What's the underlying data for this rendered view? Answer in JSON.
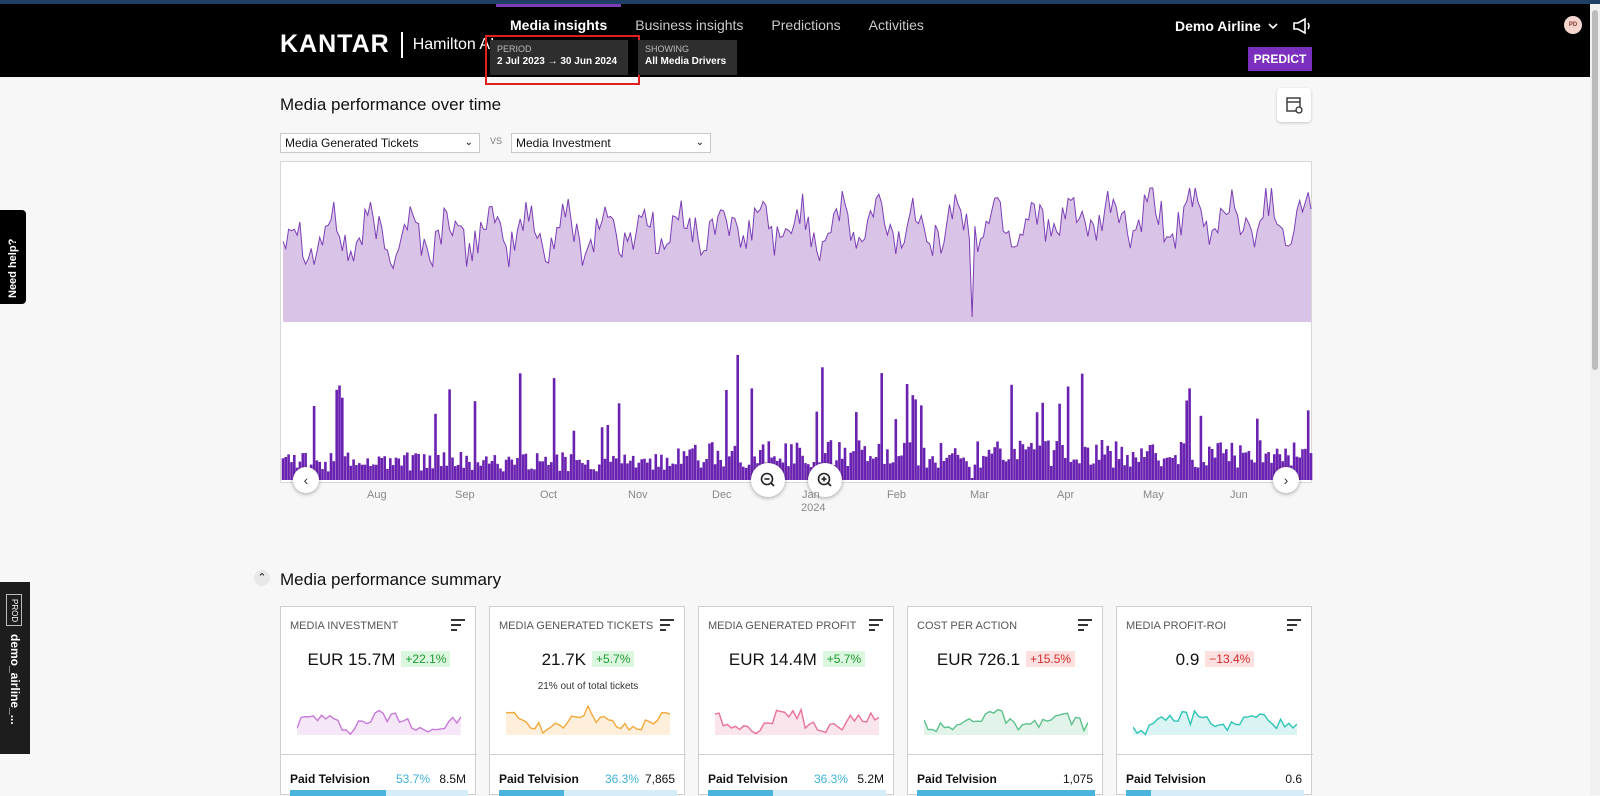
{
  "brand": {
    "logo": "KANTAR",
    "product": "Hamilton AI"
  },
  "nav": {
    "tabs": [
      "Media insights",
      "Business insights",
      "Predictions",
      "Activities"
    ],
    "active": 0
  },
  "period": {
    "label": "PERIOD",
    "value": "2 Jul 2023 → 30 Jun 2024"
  },
  "showing": {
    "label": "SHOWING",
    "value": "All Media Drivers"
  },
  "account": {
    "name": "Demo Airline",
    "predict_label": "PREDICT",
    "avatar": "PD"
  },
  "sidebar": {
    "need_help": "Need help?",
    "env": "PROD",
    "account_id": "demo_airline_..."
  },
  "performance": {
    "title": "Media performance over time",
    "metric_a": "Media Generated Tickets",
    "vs": "VS",
    "metric_b": "Media Investment",
    "months": [
      "Aug",
      "Sep",
      "Oct",
      "Nov",
      "Dec",
      "Jan",
      "Feb",
      "Mar",
      "Apr",
      "May",
      "Jun"
    ],
    "year": "2024",
    "colors": {
      "line": "#7b3fb5",
      "area": "#d9c3e6",
      "bars": "#6a22b0"
    }
  },
  "summary": {
    "title": "Media performance summary",
    "cards": [
      {
        "title": "MEDIA INVESTMENT",
        "value": "EUR 15.7M",
        "change": "+22.1%",
        "direction": "up",
        "sub": "",
        "spark_color": "#c77ad8",
        "channel": "Paid Telvision",
        "pct": "53.7%",
        "amount": "8.5M",
        "bar_fraction": 0.537
      },
      {
        "title": "MEDIA GENERATED TICKETS",
        "value": "21.7K",
        "change": "+5.7%",
        "direction": "up",
        "sub": "21% out of total tickets",
        "spark_color": "#f2a93b",
        "channel": "Paid Telvision",
        "pct": "36.3%",
        "amount": "7,865",
        "bar_fraction": 0.363
      },
      {
        "title": "MEDIA GENERATED PROFIT",
        "value": "EUR 14.4M",
        "change": "+5.7%",
        "direction": "up",
        "sub": "",
        "spark_color": "#e8709a",
        "channel": "Paid Telvision",
        "pct": "36.3%",
        "amount": "5.2M",
        "bar_fraction": 0.363
      },
      {
        "title": "COST PER ACTION",
        "value": "EUR 726.1",
        "change": "+15.5%",
        "direction": "down",
        "sub": "",
        "spark_color": "#5cc08a",
        "channel": "Paid Telvision",
        "pct": "",
        "amount": "1,075",
        "bar_fraction": 1.0
      },
      {
        "title": "MEDIA PROFIT-ROI",
        "value": "0.9",
        "change": "−13.4%",
        "direction": "down",
        "sub": "",
        "spark_color": "#2ec4b6",
        "channel": "Paid Telvision",
        "pct": "",
        "amount": "0.6",
        "bar_fraction": 0.14
      }
    ]
  }
}
